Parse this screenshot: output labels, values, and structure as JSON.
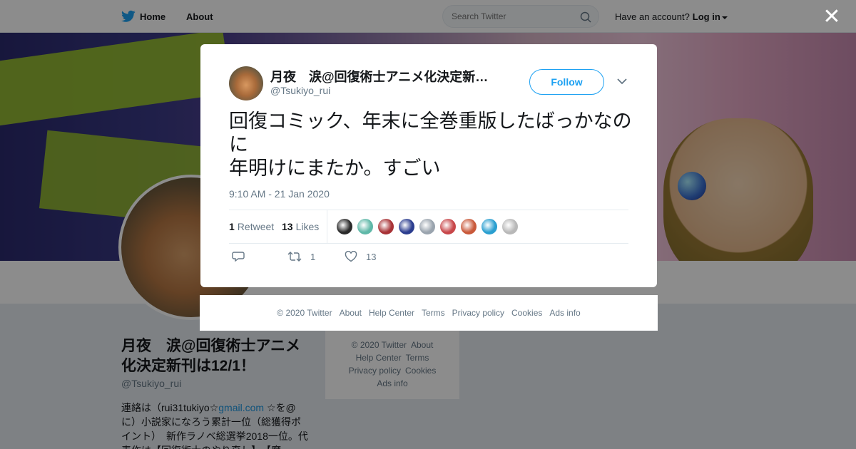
{
  "topbar": {
    "home_label": "Home",
    "about_label": "About",
    "search_placeholder": "Search Twitter",
    "account_prompt": "Have an account?",
    "login_label": "Log in"
  },
  "profile": {
    "name": "月夜　涙@回復術士アニメ化決定新刊は12/1！",
    "handle": "@Tsukiyo_rui",
    "bio_prefix": "連絡は（rui31tukiyo☆",
    "bio_link": "gmail.com",
    "bio_suffix": " ☆を@に）小説家になろう累計一位（総獲得ポイント）　新作ラノベ総選挙2018一位。代表作は【回復術士のやり直し】、【魔"
  },
  "side_footer": [
    "© 2020 Twitter",
    "About",
    "Help Center",
    "Terms",
    "Privacy policy",
    "Cookies",
    "Ads info"
  ],
  "tweet": {
    "author_name": "月夜　涙@回復術士アニメ化決定新…",
    "author_handle": "@Tsukiyo_rui",
    "follow_label": "Follow",
    "text": "回復コミック、年末に全巻重版したばっかなのに\n年明けにまたか。すごい",
    "timestamp": "9:10 AM - 21 Jan 2020",
    "retweet_count": "1",
    "retweet_label": "Retweet",
    "like_count": "13",
    "like_label": "Likes",
    "action_retweet_count": "1",
    "action_like_count": "13",
    "liker_colors": [
      "#2a2a2a",
      "#5fb8a8",
      "#a83236",
      "#2b3d8f",
      "#9aa4ae",
      "#c8474a",
      "#c9593a",
      "#2a9fd0",
      "#b8b8b8"
    ]
  },
  "modal_footer": [
    "© 2020 Twitter",
    "About",
    "Help Center",
    "Terms",
    "Privacy policy",
    "Cookies",
    "Ads info"
  ],
  "colors": {
    "accent": "#1da1f2",
    "text": "#14171a",
    "muted": "#657786"
  }
}
